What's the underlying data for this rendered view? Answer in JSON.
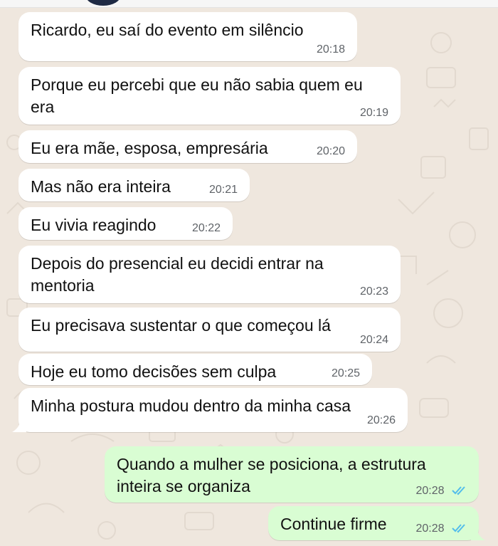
{
  "colors": {
    "background": "#efe7de",
    "incoming_bubble": "#ffffff",
    "outgoing_bubble": "#d9fdd3",
    "timestamp": "#5f6368",
    "read_ticks": "#53bdeb"
  },
  "messages": [
    {
      "text": "Ricardo, eu saí do evento em silêncio",
      "time": "20:18",
      "direction": "incoming"
    },
    {
      "text": "Porque eu percebi que eu não sabia quem eu era",
      "time": "20:19",
      "direction": "incoming"
    },
    {
      "text": "Eu era mãe, esposa, empresária",
      "time": "20:20",
      "direction": "incoming"
    },
    {
      "text": "Mas não era inteira",
      "time": "20:21",
      "direction": "incoming"
    },
    {
      "text": "Eu vivia reagindo",
      "time": "20:22",
      "direction": "incoming"
    },
    {
      "text": "Depois do presencial eu decidi entrar na mentoria",
      "time": "20:23",
      "direction": "incoming"
    },
    {
      "text": "Eu precisava sustentar o que começou lá",
      "time": "20:24",
      "direction": "incoming"
    },
    {
      "text": "Hoje eu tomo decisões sem culpa",
      "time": "20:25",
      "direction": "incoming"
    },
    {
      "text": "Minha postura mudou dentro da minha casa",
      "time": "20:26",
      "direction": "incoming"
    },
    {
      "text": "Quando a mulher se posiciona, a estrutura inteira se organiza",
      "time": "20:28",
      "direction": "outgoing",
      "status": "read"
    },
    {
      "text": "Continue firme",
      "time": "20:28",
      "direction": "outgoing",
      "status": "read"
    }
  ]
}
